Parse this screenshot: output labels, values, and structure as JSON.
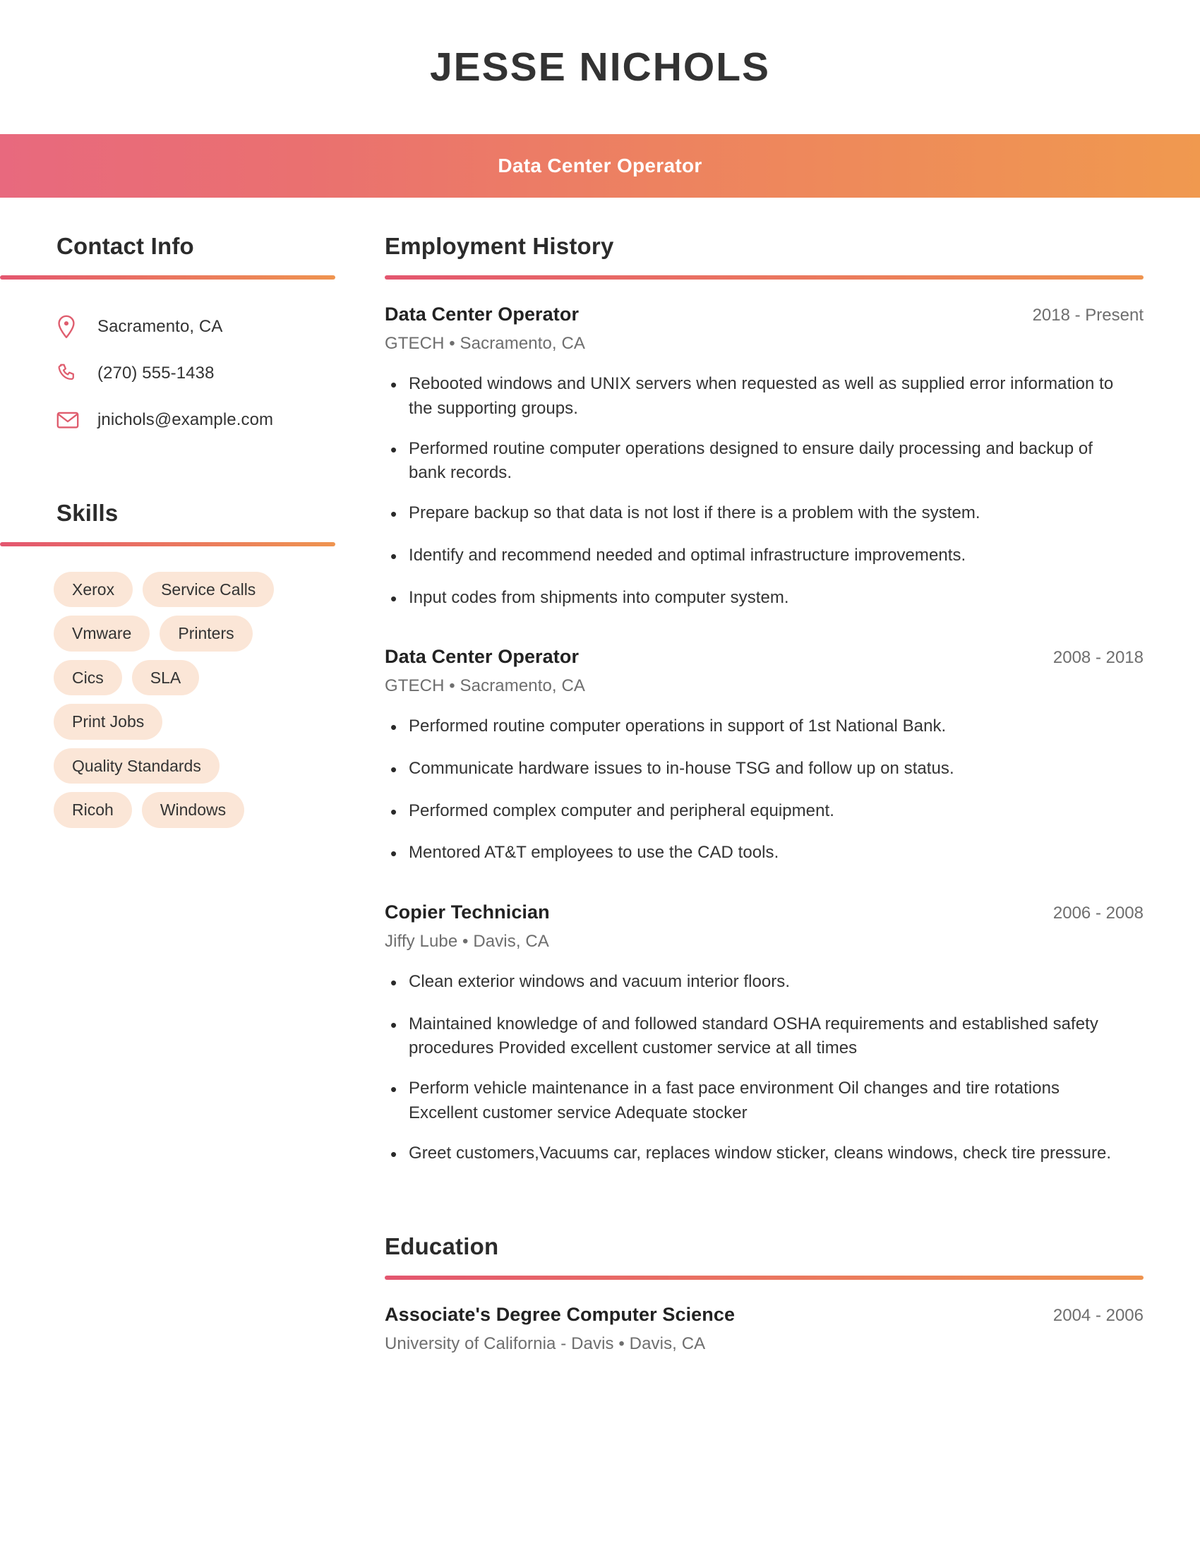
{
  "header": {
    "full_name": "JESSE NICHOLS",
    "job_title": "Data Center Operator",
    "banner_gradient_start": "#e8697e",
    "banner_gradient_end": "#f0994f"
  },
  "sidebar": {
    "contact": {
      "heading": "Contact Info",
      "items": [
        {
          "icon": "location-pin-icon",
          "value": "Sacramento, CA"
        },
        {
          "icon": "phone-icon",
          "value": "(270) 555-1438"
        },
        {
          "icon": "envelope-icon",
          "value": "jnichols@example.com"
        }
      ]
    },
    "skills": {
      "heading": "Skills",
      "pill_background": "#fbe6d7",
      "items": [
        "Xerox",
        "Service Calls",
        "Vmware",
        "Printers",
        "Cics",
        "SLA",
        "Print Jobs",
        "Quality Standards",
        "Ricoh",
        "Windows"
      ]
    }
  },
  "main": {
    "employment": {
      "heading": "Employment History",
      "entries": [
        {
          "role": "Data Center Operator",
          "dates": "2018 - Present",
          "company": "GTECH",
          "separator": "•",
          "location": "Sacramento, CA",
          "bullets": [
            "Rebooted windows and UNIX servers when requested as well as supplied error information to the supporting groups.",
            "Performed routine computer operations designed to ensure daily processing and backup of bank records.",
            "Prepare backup so that data is not lost if there is a problem with the system.",
            "Identify and recommend needed and optimal infrastructure improvements.",
            "Input codes from shipments into computer system."
          ]
        },
        {
          "role": "Data Center Operator",
          "dates": "2008 - 2018",
          "company": "GTECH",
          "separator": "•",
          "location": "Sacramento, CA",
          "bullets": [
            "Performed routine computer operations in support of 1st National Bank.",
            "Communicate hardware issues to in-house TSG and follow up on status.",
            "Performed complex computer and peripheral equipment.",
            "Mentored AT&T employees to use the CAD tools."
          ]
        },
        {
          "role": "Copier Technician",
          "dates": "2006 - 2008",
          "company": "Jiffy Lube",
          "separator": "•",
          "location": "Davis, CA",
          "bullets": [
            "Clean exterior windows and vacuum interior floors.",
            "Maintained knowledge of and followed standard OSHA requirements and established safety procedures Provided excellent customer service at all times",
            "Perform vehicle maintenance in a fast pace environment Oil changes and tire rotations Excellent customer service Adequate stocker",
            "Greet customers,Vacuums car, replaces window sticker, cleans windows, check tire pressure."
          ]
        }
      ]
    },
    "education": {
      "heading": "Education",
      "entries": [
        {
          "degree": "Associate's Degree Computer Science",
          "dates": "2004 - 2006",
          "school": "University of California - Davis",
          "separator": "•",
          "location": "Davis, CA"
        }
      ]
    }
  },
  "icons": {
    "bullet_glyph": "•",
    "accent_color": "#df5d6e"
  }
}
